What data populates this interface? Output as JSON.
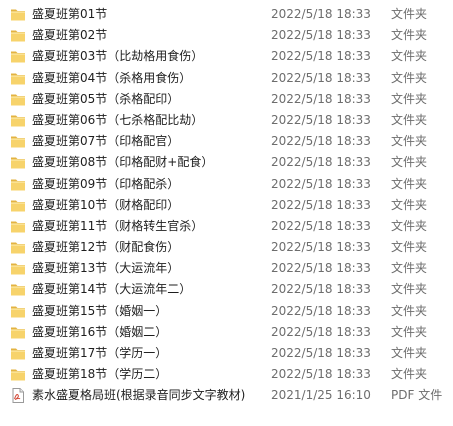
{
  "files": [
    {
      "name": "盛夏班第01节",
      "date": "2022/5/18 18:33",
      "type": "文件夹",
      "icon": "folder-icon"
    },
    {
      "name": "盛夏班第02节",
      "date": "2022/5/18 18:33",
      "type": "文件夹",
      "icon": "folder-icon"
    },
    {
      "name": "盛夏班第03节（比劫格用食伤）",
      "date": "2022/5/18 18:33",
      "type": "文件夹",
      "icon": "folder-icon"
    },
    {
      "name": "盛夏班第04节（杀格用食伤）",
      "date": "2022/5/18 18:33",
      "type": "文件夹",
      "icon": "folder-icon"
    },
    {
      "name": "盛夏班第05节（杀格配印）",
      "date": "2022/5/18 18:33",
      "type": "文件夹",
      "icon": "folder-icon"
    },
    {
      "name": "盛夏班第06节（七杀格配比劫）",
      "date": "2022/5/18 18:33",
      "type": "文件夹",
      "icon": "folder-icon"
    },
    {
      "name": "盛夏班第07节（印格配官）",
      "date": "2022/5/18 18:33",
      "type": "文件夹",
      "icon": "folder-icon"
    },
    {
      "name": "盛夏班第08节（印格配财+配食）",
      "date": "2022/5/18 18:33",
      "type": "文件夹",
      "icon": "folder-icon"
    },
    {
      "name": "盛夏班第09节（印格配杀）",
      "date": "2022/5/18 18:33",
      "type": "文件夹",
      "icon": "folder-icon"
    },
    {
      "name": "盛夏班第10节（财格配印）",
      "date": "2022/5/18 18:33",
      "type": "文件夹",
      "icon": "folder-icon"
    },
    {
      "name": "盛夏班第11节（财格转生官杀）",
      "date": "2022/5/18 18:33",
      "type": "文件夹",
      "icon": "folder-icon"
    },
    {
      "name": "盛夏班第12节（财配食伤）",
      "date": "2022/5/18 18:33",
      "type": "文件夹",
      "icon": "folder-icon"
    },
    {
      "name": "盛夏班第13节（大运流年）",
      "date": "2022/5/18 18:33",
      "type": "文件夹",
      "icon": "folder-icon"
    },
    {
      "name": "盛夏班第14节（大运流年二）",
      "date": "2022/5/18 18:33",
      "type": "文件夹",
      "icon": "folder-icon"
    },
    {
      "name": "盛夏班第15节（婚姻一）",
      "date": "2022/5/18 18:33",
      "type": "文件夹",
      "icon": "folder-icon"
    },
    {
      "name": "盛夏班第16节（婚姻二）",
      "date": "2022/5/18 18:33",
      "type": "文件夹",
      "icon": "folder-icon"
    },
    {
      "name": "盛夏班第17节（学历一）",
      "date": "2022/5/18 18:33",
      "type": "文件夹",
      "icon": "folder-icon"
    },
    {
      "name": "盛夏班第18节（学历二）",
      "date": "2022/5/18 18:33",
      "type": "文件夹",
      "icon": "folder-icon"
    },
    {
      "name": "素水盛夏格局班(根据录音同步文字教材)",
      "date": "2021/1/25 16:10",
      "type": "PDF 文件",
      "icon": "pdf-file-icon"
    }
  ]
}
